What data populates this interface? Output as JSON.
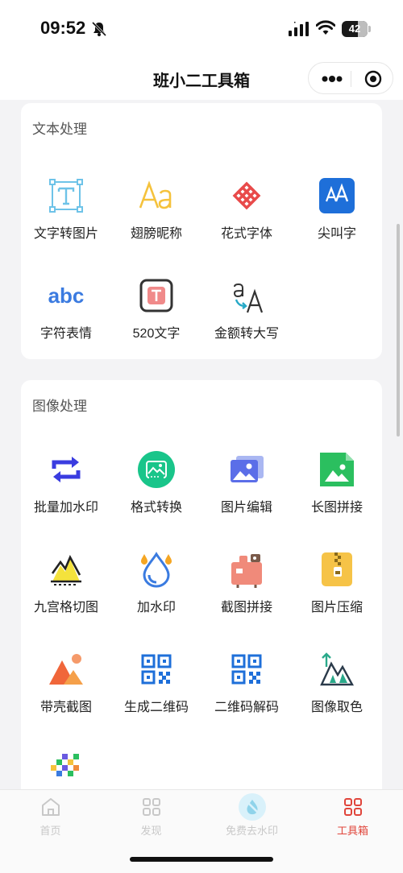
{
  "status": {
    "time": "09:52",
    "battery": "42"
  },
  "nav": {
    "title": "班小二工具箱"
  },
  "sections": [
    {
      "title": "文本处理",
      "tools": [
        {
          "label": "文字转图片",
          "icon": "text-frame-icon"
        },
        {
          "label": "翅膀昵称",
          "icon": "aa-font-icon"
        },
        {
          "label": "花式字体",
          "icon": "knot-icon"
        },
        {
          "label": "尖叫字",
          "icon": "aa-badge-icon"
        },
        {
          "label": "字符表情",
          "icon": "abc-icon"
        },
        {
          "label": "520文字",
          "icon": "t-box-icon"
        },
        {
          "label": "金额转大写",
          "icon": "a-to-a-icon"
        }
      ]
    },
    {
      "title": "图像处理",
      "tools": [
        {
          "label": "批量加水印",
          "icon": "repeat-icon"
        },
        {
          "label": "格式转换",
          "icon": "image-convert-icon"
        },
        {
          "label": "图片编辑",
          "icon": "photos-icon"
        },
        {
          "label": "长图拼接",
          "icon": "image-file-icon"
        },
        {
          "label": "九宫格切图",
          "icon": "mountain-crop-icon"
        },
        {
          "label": "加水印",
          "icon": "water-drop-icon"
        },
        {
          "label": "截图拼接",
          "icon": "puzzle-icon"
        },
        {
          "label": "图片压缩",
          "icon": "zip-icon"
        },
        {
          "label": "带壳截图",
          "icon": "landscape-icon"
        },
        {
          "label": "生成二维码",
          "icon": "qr-code-icon"
        },
        {
          "label": "二维码解码",
          "icon": "qr-scan-icon"
        },
        {
          "label": "图像取色",
          "icon": "mountain-arrow-icon"
        },
        {
          "label": "",
          "icon": "pixel-mosaic-icon"
        }
      ]
    }
  ],
  "tabbar": [
    {
      "label": "首页",
      "icon": "home-icon"
    },
    {
      "label": "发现",
      "icon": "grid-icon"
    },
    {
      "label": "免费去水印",
      "icon": "watermark-remove-icon"
    },
    {
      "label": "工具箱",
      "icon": "toolbox-icon",
      "active": true
    }
  ],
  "colors": {
    "accent": "#e0453b",
    "blue": "#1e6fd9"
  }
}
